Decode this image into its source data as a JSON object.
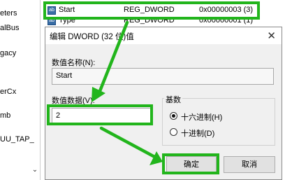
{
  "tree": {
    "items": [
      "eters",
      "alBus",
      "gacy",
      "erCx",
      "mb",
      "UU_TAP_"
    ],
    "scroll_glyph": "⌄"
  },
  "list": {
    "rows": [
      {
        "name": "Start",
        "type": "REG_DWORD",
        "data": "0x00000003 (3)"
      },
      {
        "name": "Type",
        "type": "REG_DWORD",
        "data": "0x00000001 (1)"
      }
    ]
  },
  "dialog": {
    "title": "编辑 DWORD (32 位)值",
    "close_glyph": "✕",
    "value_name_label": "数值名称(N):",
    "value_name": "Start",
    "value_data_label": "数值数据(V):",
    "value_data": "2",
    "base_label": "基数",
    "hex_label": "十六进制(H)",
    "dec_label": "十进制(D)",
    "selected_base": "hex",
    "ok_label": "确定",
    "cancel_label": "取消"
  },
  "colors": {
    "highlight": "#22b51c"
  }
}
